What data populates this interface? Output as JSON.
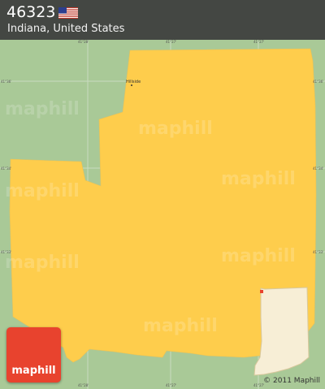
{
  "header": {
    "zip": "46323",
    "location": "Indiana, United States"
  },
  "map": {
    "colors": {
      "background": "#a9c997",
      "area": "#fecd4c",
      "grid": "#c9dcc0",
      "marker": "#e8432e",
      "inset": "#f7eed6"
    },
    "city_label": "Hillside",
    "coordinates": {
      "top": [
        "41°28'",
        "41°27'",
        "41°27'"
      ],
      "bottom": [
        "41°28'",
        "41°27'",
        "41°27'"
      ],
      "left": [
        "41°36'",
        "41°34'",
        "41°33'"
      ],
      "right": [
        "41°36'",
        "41°34'",
        "41°33'"
      ]
    },
    "watermark": "maphill",
    "flag_icon": "us-flag-icon"
  },
  "logo": {
    "text": "maphill"
  },
  "copyright": "© 2011 Maphill"
}
